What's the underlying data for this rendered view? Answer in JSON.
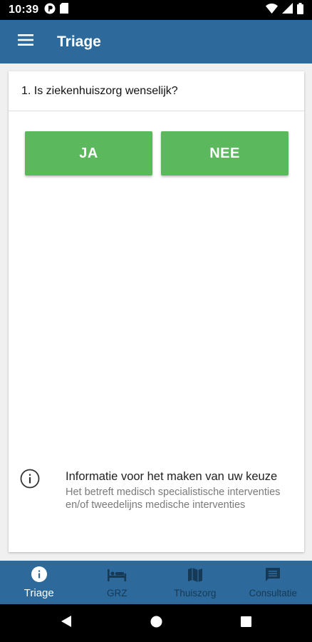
{
  "status_bar": {
    "time": "10:39",
    "icons_left": [
      "app-notification-icon",
      "sim-card-icon"
    ],
    "icons_right": [
      "wifi-icon",
      "cellular-signal-icon",
      "battery-icon"
    ]
  },
  "app_bar": {
    "title": "Triage",
    "menu_icon": "hamburger-menu-icon"
  },
  "question": {
    "text": "1. Is ziekenhuiszorg wenselijk?",
    "answers": [
      {
        "label": "JA"
      },
      {
        "label": "NEE"
      }
    ],
    "answer_color": "#5cb85c"
  },
  "info": {
    "icon": "info-icon",
    "title": "Informatie voor het maken van uw keuze",
    "description": "Het betreft medisch specialistische interventies en/of tweedelijns medische interventies"
  },
  "bottom_nav": {
    "items": [
      {
        "label": "Triage",
        "icon": "info-filled-icon",
        "active": true
      },
      {
        "label": "GRZ",
        "icon": "bed-icon",
        "active": false
      },
      {
        "label": "Thuiszorg",
        "icon": "map-icon",
        "active": false
      },
      {
        "label": "Consultatie",
        "icon": "chat-icon",
        "active": false
      }
    ]
  },
  "colors": {
    "primary": "#2d6a9b",
    "button": "#5cb85c",
    "nav_inactive": "#163a55"
  }
}
